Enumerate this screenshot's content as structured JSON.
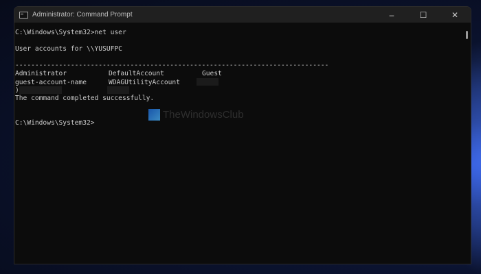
{
  "window": {
    "title": "Administrator: Command Prompt",
    "minimize": "–",
    "maximize": "☐",
    "close": "✕"
  },
  "console": {
    "command_line": "C:\\Windows\\System32>net user",
    "accounts_header": "User accounts for \\\\YUSUFPC",
    "separator": "-------------------------------------------------------------------------------",
    "row1": [
      "Administrator",
      "DefaultAccount",
      "Guest"
    ],
    "row2": [
      "guest-account-name",
      "WDAGUtilityAccount"
    ],
    "row3_start": ")",
    "result": "The command completed successfully.",
    "prompt": "C:\\Windows\\System32>"
  },
  "watermark": "TheWindowsClub"
}
